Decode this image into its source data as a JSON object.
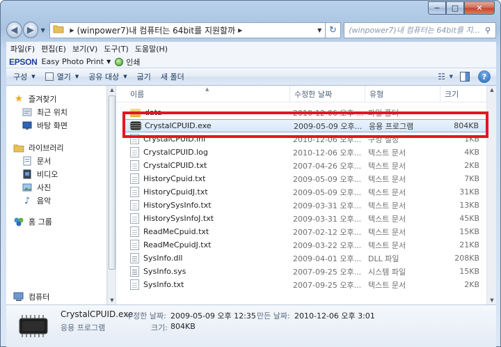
{
  "window": {
    "controls": {
      "minimize": "−",
      "maximize": "□",
      "close": "✕"
    }
  },
  "address": {
    "path": "(winpower7)내 컴퓨터는 64bit를 지원할까",
    "search_placeholder": "(winpower7)내 컴퓨터는 64bit를 지..."
  },
  "menu": [
    "파일(F)",
    "편집(E)",
    "보기(V)",
    "도구(T)",
    "도움말(H)"
  ],
  "epson": {
    "logo": "EPSON",
    "app": "Easy Photo Print",
    "print": "인쇄"
  },
  "commands": {
    "organize": "구성",
    "open": "열기",
    "share": "공유 대상",
    "burn": "굽기",
    "new_folder": "새 폴더"
  },
  "navpane": {
    "favorites": "즐겨찾기",
    "recent": "최근 위치",
    "desktop": "바탕 화면",
    "libraries": "라이브러리",
    "documents": "문서",
    "videos": "비디오",
    "pictures": "사진",
    "music": "음악",
    "homegroup": "홈 그룹",
    "computer": "컴퓨터"
  },
  "columns": {
    "name": "이름",
    "date": "수정한 날짜",
    "type": "유형",
    "size": "크기"
  },
  "files": [
    {
      "name": "data",
      "date": "2010-12-06 오후 ...",
      "type": "파일 폴더",
      "size": "",
      "icon": "folder"
    },
    {
      "name": "CrystalCPUID.exe",
      "date": "2009-05-09 오후...",
      "type": "응용 프로그램",
      "size": "804KB",
      "icon": "exe"
    },
    {
      "name": "CrystalCPUID.ini",
      "date": "2010-12-06 오후...",
      "type": "구성 설정",
      "size": "1KB",
      "icon": "ini"
    },
    {
      "name": "CrystalCPUID.log",
      "date": "2010-12-06 오후...",
      "type": "텍스트 문서",
      "size": "4KB",
      "icon": "txt"
    },
    {
      "name": "CrystalCPUID.txt",
      "date": "2007-04-26 오후...",
      "type": "텍스트 문서",
      "size": "2KB",
      "icon": "txt"
    },
    {
      "name": "HistoryCpuid.txt",
      "date": "2009-05-09 오후...",
      "type": "텍스트 문서",
      "size": "7KB",
      "icon": "txt"
    },
    {
      "name": "HistoryCpuidJ.txt",
      "date": "2009-05-09 오후...",
      "type": "텍스트 문서",
      "size": "31KB",
      "icon": "txt"
    },
    {
      "name": "HistorySysInfo.txt",
      "date": "2009-03-31 오후...",
      "type": "텍스트 문서",
      "size": "13KB",
      "icon": "txt"
    },
    {
      "name": "HistorySysInfoJ.txt",
      "date": "2009-03-31 오후...",
      "type": "텍스트 문서",
      "size": "45KB",
      "icon": "txt"
    },
    {
      "name": "ReadMeCpuid.txt",
      "date": "2007-02-12 오후...",
      "type": "텍스트 문서",
      "size": "15KB",
      "icon": "txt"
    },
    {
      "name": "ReadMeCpuidJ.txt",
      "date": "2009-03-22 오후...",
      "type": "텍스트 문서",
      "size": "21KB",
      "icon": "txt"
    },
    {
      "name": "SysInfo.dll",
      "date": "2009-04-01 오후...",
      "type": "DLL 파일",
      "size": "208KB",
      "icon": "dll"
    },
    {
      "name": "SysInfo.sys",
      "date": "2007-09-25 오후...",
      "type": "시스템 파일",
      "size": "15KB",
      "icon": "sys"
    },
    {
      "name": "SysInfo.txt",
      "date": "2007-09-25 오후...",
      "type": "텍스트 문서",
      "size": "2KB",
      "icon": "txt"
    }
  ],
  "selected_index": 1,
  "details": {
    "filename": "CrystalCPUID.exe",
    "filetype": "응용 프로그램",
    "modified_label": "수정한 날짜:",
    "modified_value": "2009-05-09 오후 12:35",
    "created_label": "만든 날짜:",
    "created_value": "2010-12-06 오후 3:01",
    "size_label": "크기:",
    "size_value": "804KB"
  },
  "colors": {
    "highlight_box": "#e0191e",
    "selection": "#d4e7fb",
    "epson_blue": "#1a3fa0"
  }
}
